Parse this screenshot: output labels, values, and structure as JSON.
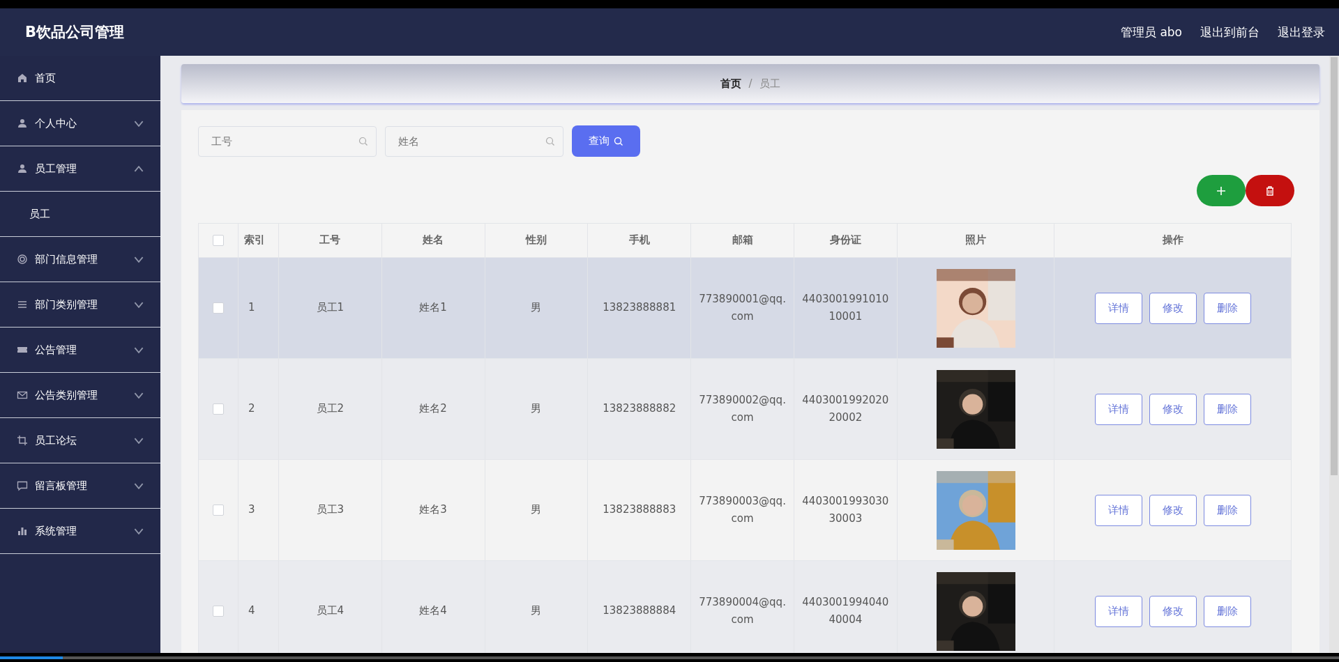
{
  "header": {
    "title": "B饮品公司管理",
    "links": [
      "管理员 abo",
      "退出到前台",
      "退出登录"
    ]
  },
  "sidebar": {
    "items": [
      {
        "label": "首页"
      },
      {
        "label": "个人中心",
        "expanded": false
      },
      {
        "label": "员工管理",
        "expanded": true,
        "children": [
          {
            "label": "员工"
          }
        ]
      },
      {
        "label": "部门信息管理",
        "expanded": false
      },
      {
        "label": "部门类别管理",
        "expanded": false
      },
      {
        "label": "公告管理",
        "expanded": false
      },
      {
        "label": "公告类别管理",
        "expanded": false
      },
      {
        "label": "员工论坛",
        "expanded": false
      },
      {
        "label": "留言板管理",
        "expanded": false
      },
      {
        "label": "系统管理",
        "expanded": false
      }
    ]
  },
  "breadcrumb": {
    "items": [
      "首页",
      "员工"
    ],
    "separator": "/"
  },
  "search": {
    "fields": [
      {
        "placeholder": "工号"
      },
      {
        "placeholder": "姓名"
      }
    ],
    "button": "查询"
  },
  "table": {
    "all_checked": false,
    "columns": [
      "索引",
      "工号",
      "姓名",
      "性别",
      "手机",
      "邮箱",
      "身份证",
      "照片",
      "操作"
    ],
    "rows": [
      {
        "checked": false,
        "hovered": true,
        "cells": [
          "1",
          "员工1",
          "姓名1",
          "男",
          "13823888881",
          "773890001@qq.com",
          "440300199101010001"
        ],
        "photo": {
          "kind": "picture"
        },
        "actions": [
          "详情",
          "修改",
          "删除"
        ]
      },
      {
        "checked": false,
        "hovered": false,
        "cells": [
          "2",
          "员工2",
          "姓名2",
          "男",
          "13823888882",
          "773890002@qq.com",
          "440300199202020002"
        ],
        "photo": {
          "kind": "picture"
        },
        "actions": [
          "详情",
          "修改",
          "删除"
        ]
      },
      {
        "checked": false,
        "hovered": false,
        "cells": [
          "3",
          "员工3",
          "姓名3",
          "男",
          "13823888883",
          "773890003@qq.com",
          "440300199303030003"
        ],
        "photo": {
          "kind": "picture"
        },
        "actions": [
          "详情",
          "修改",
          "删除"
        ]
      },
      {
        "checked": false,
        "hovered": false,
        "cells": [
          "4",
          "员工4",
          "姓名4",
          "男",
          "13823888884",
          "773890004@qq.com",
          "440300199404040004"
        ],
        "photo": {
          "kind": "picture"
        },
        "actions": [
          "详情",
          "修改",
          "删除"
        ]
      }
    ]
  },
  "player": {
    "level": 0.047
  }
}
